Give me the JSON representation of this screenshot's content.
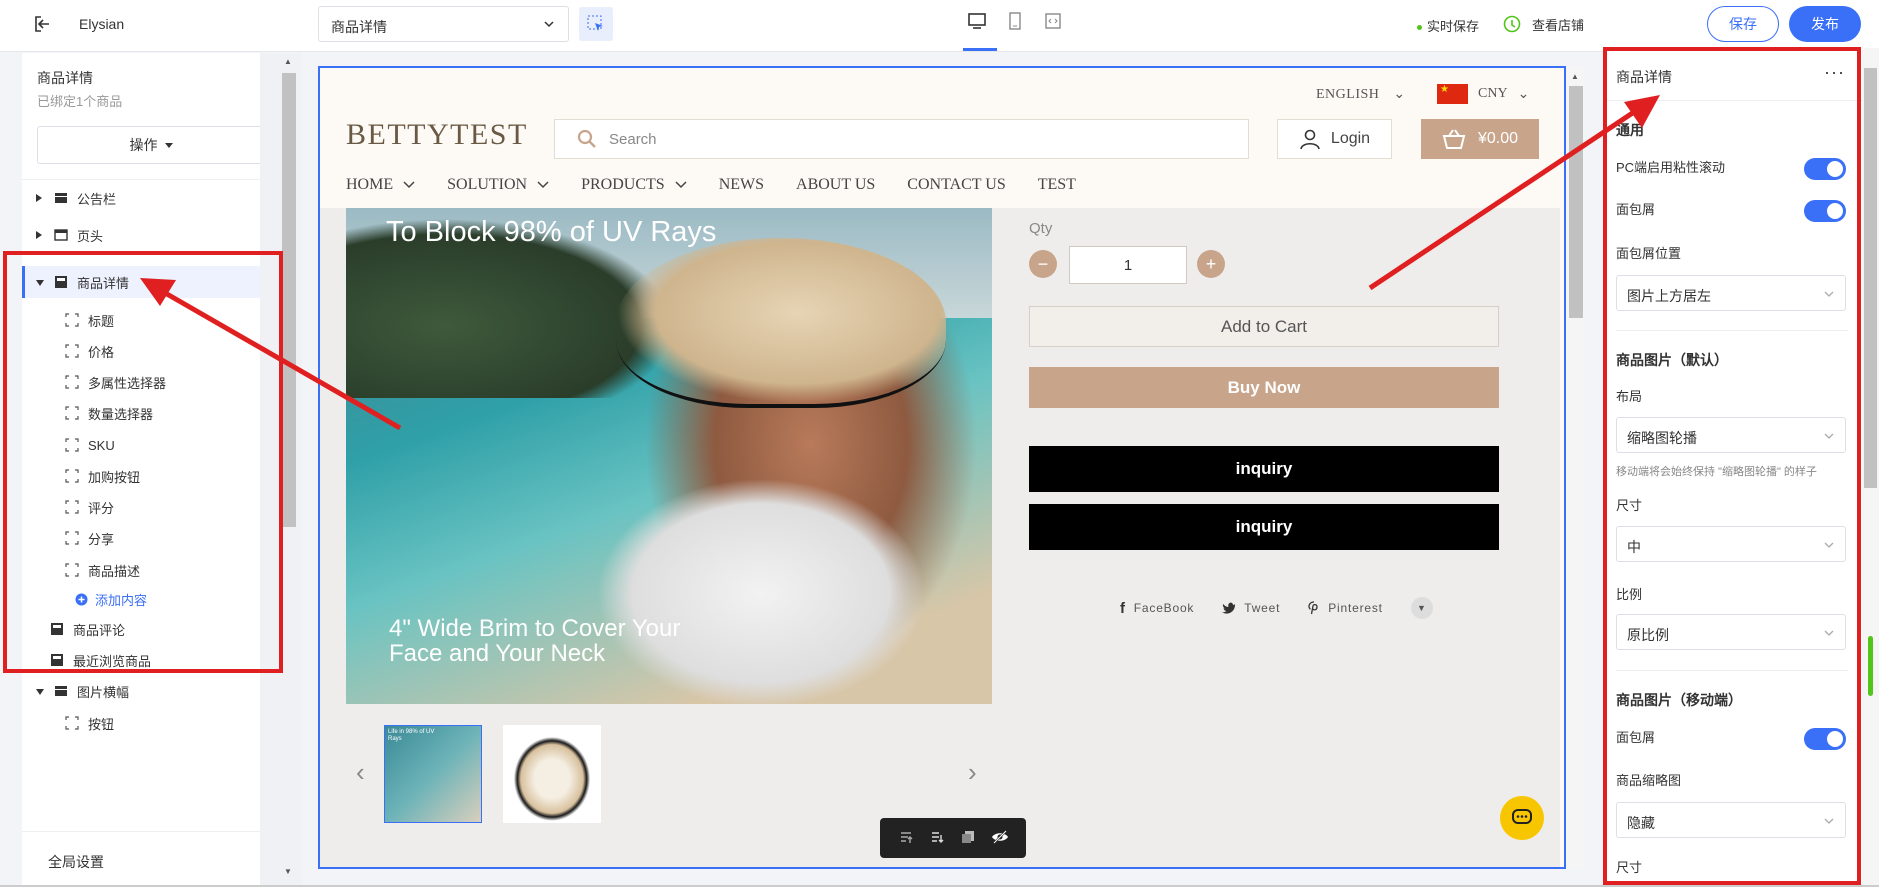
{
  "topbar": {
    "app_name": "Elysian",
    "page_select": "商品详情",
    "autosave": "实时保存",
    "view_shop": "查看店铺",
    "save": "保存",
    "publish": "发布"
  },
  "left": {
    "title": "商品详情",
    "subtitle": "已绑定1个商品",
    "ops": "操作",
    "tree": [
      {
        "label": "公告栏"
      },
      {
        "label": "页头"
      },
      {
        "label": "商品详情"
      },
      {
        "label": "标题"
      },
      {
        "label": "价格"
      },
      {
        "label": "多属性选择器"
      },
      {
        "label": "数量选择器"
      },
      {
        "label": "SKU"
      },
      {
        "label": "加购按钮"
      },
      {
        "label": "评分"
      },
      {
        "label": "分享"
      },
      {
        "label": "商品描述"
      },
      {
        "label": "添加内容"
      },
      {
        "label": "商品评论"
      },
      {
        "label": "最近浏览商品"
      },
      {
        "label": "图片横幅"
      },
      {
        "label": "按钮"
      }
    ],
    "global": "全局设置"
  },
  "store": {
    "language": "ENGLISH",
    "currency": "CNY",
    "logo": "BETTYTEST",
    "search_placeholder": "Search",
    "login": "Login",
    "cart_total": "¥0.00",
    "nav": [
      "HOME",
      "SOLUTION",
      "PRODUCTS",
      "NEWS",
      "ABOUT US",
      "CONTACT US",
      "TEST"
    ],
    "hero_text_top": "To Block 98% of UV Rays",
    "hero_text_bottom": "4\" Wide Brim to Cover Your Face and Your Neck",
    "thumb1_text": "Life in 98% of UV Rays",
    "qty_label": "Qty",
    "qty_value": "1",
    "add_to_cart": "Add to Cart",
    "buy_now": "Buy Now",
    "inquiry1": "inquiry",
    "inquiry2": "inquiry",
    "share": {
      "facebook": "FaceBook",
      "tweet": "Tweet",
      "pinterest": "Pinterest"
    }
  },
  "right": {
    "title": "商品详情",
    "section_general": "通用",
    "pc_sticky": "PC端启用粘性滚动",
    "breadcrumb": "面包屑",
    "breadcrumb_pos": "面包屑位置",
    "breadcrumb_pos_value": "图片上方居左",
    "section_images_default": "商品图片（默认）",
    "layout": "布局",
    "layout_value": "缩略图轮播",
    "layout_hint": "移动端将会始终保持 \"缩略图轮播\" 的样子",
    "size": "尺寸",
    "size_value": "中",
    "ratio": "比例",
    "ratio_value": "原比例",
    "section_images_mobile": "商品图片（移动端）",
    "breadcrumb_mobile": "面包屑",
    "thumbnail": "商品缩略图",
    "thumbnail_value": "隐藏",
    "size_mobile": "尺寸"
  },
  "colors": {
    "accent": "#3a6ff7",
    "brand_tan": "#c8a48b",
    "annotation_red": "#e02020"
  }
}
